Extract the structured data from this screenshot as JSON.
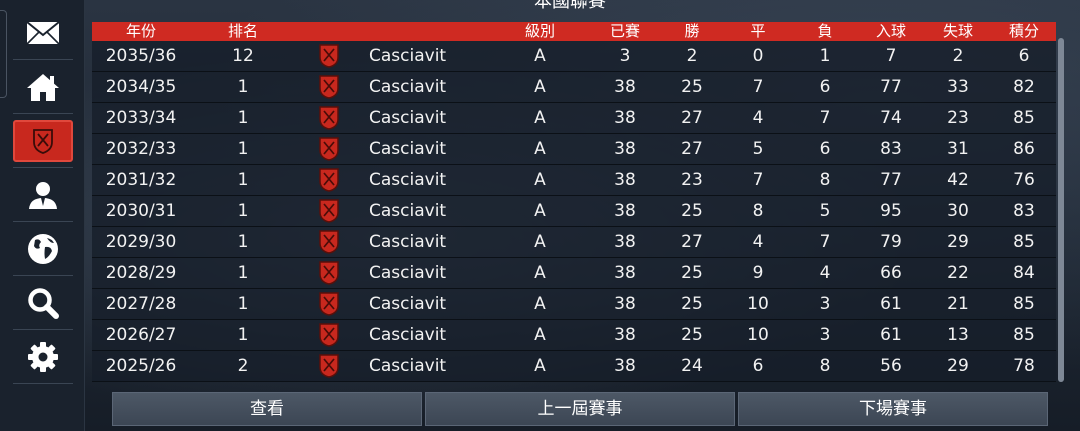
{
  "header": {
    "title": "本國聯賽"
  },
  "sidebar": {
    "items": [
      {
        "name": "mail",
        "icon": "mail-icon"
      },
      {
        "name": "home",
        "icon": "home-icon"
      },
      {
        "name": "club",
        "icon": "club-crest-icon",
        "active": true
      },
      {
        "name": "manager",
        "icon": "manager-icon"
      },
      {
        "name": "world",
        "icon": "globe-icon"
      },
      {
        "name": "search",
        "icon": "search-icon"
      },
      {
        "name": "settings",
        "icon": "gear-icon"
      }
    ]
  },
  "table": {
    "columns": {
      "season": "年份",
      "rank": "排名",
      "division": "級別",
      "played": "已賽",
      "won": "勝",
      "drawn": "平",
      "lost": "負",
      "goals_for": "入球",
      "goals_against": "失球",
      "points": "積分"
    },
    "rows": [
      {
        "season": "2035/36",
        "rank": "12",
        "club": "Casciavit",
        "division": "A",
        "played": "3",
        "won": "2",
        "drawn": "0",
        "lost": "1",
        "gf": "7",
        "ga": "2",
        "pts": "6"
      },
      {
        "season": "2034/35",
        "rank": "1",
        "club": "Casciavit",
        "division": "A",
        "played": "38",
        "won": "25",
        "drawn": "7",
        "lost": "6",
        "gf": "77",
        "ga": "33",
        "pts": "82"
      },
      {
        "season": "2033/34",
        "rank": "1",
        "club": "Casciavit",
        "division": "A",
        "played": "38",
        "won": "27",
        "drawn": "4",
        "lost": "7",
        "gf": "74",
        "ga": "23",
        "pts": "85"
      },
      {
        "season": "2032/33",
        "rank": "1",
        "club": "Casciavit",
        "division": "A",
        "played": "38",
        "won": "27",
        "drawn": "5",
        "lost": "6",
        "gf": "83",
        "ga": "31",
        "pts": "86"
      },
      {
        "season": "2031/32",
        "rank": "1",
        "club": "Casciavit",
        "division": "A",
        "played": "38",
        "won": "23",
        "drawn": "7",
        "lost": "8",
        "gf": "77",
        "ga": "42",
        "pts": "76"
      },
      {
        "season": "2030/31",
        "rank": "1",
        "club": "Casciavit",
        "division": "A",
        "played": "38",
        "won": "25",
        "drawn": "8",
        "lost": "5",
        "gf": "95",
        "ga": "30",
        "pts": "83"
      },
      {
        "season": "2029/30",
        "rank": "1",
        "club": "Casciavit",
        "division": "A",
        "played": "38",
        "won": "27",
        "drawn": "4",
        "lost": "7",
        "gf": "79",
        "ga": "29",
        "pts": "85"
      },
      {
        "season": "2028/29",
        "rank": "1",
        "club": "Casciavit",
        "division": "A",
        "played": "38",
        "won": "25",
        "drawn": "9",
        "lost": "4",
        "gf": "66",
        "ga": "22",
        "pts": "84"
      },
      {
        "season": "2027/28",
        "rank": "1",
        "club": "Casciavit",
        "division": "A",
        "played": "38",
        "won": "25",
        "drawn": "10",
        "lost": "3",
        "gf": "61",
        "ga": "21",
        "pts": "85"
      },
      {
        "season": "2026/27",
        "rank": "1",
        "club": "Casciavit",
        "division": "A",
        "played": "38",
        "won": "25",
        "drawn": "10",
        "lost": "3",
        "gf": "61",
        "ga": "13",
        "pts": "85"
      },
      {
        "season": "2025/26",
        "rank": "2",
        "club": "Casciavit",
        "division": "A",
        "played": "38",
        "won": "24",
        "drawn": "6",
        "lost": "8",
        "gf": "56",
        "ga": "29",
        "pts": "78"
      }
    ]
  },
  "buttons": {
    "view": "查看",
    "previous_season": "上一屆賽事",
    "next_match": "下場賽事"
  },
  "colors": {
    "accent_red": "#cf2a22",
    "row_bg": "#161e29",
    "button_bg": "#4d5866"
  }
}
